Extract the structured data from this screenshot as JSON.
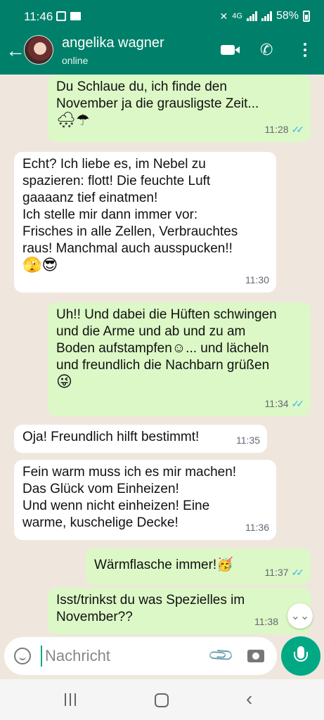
{
  "status_bar": {
    "time": "11:46",
    "network": "4G",
    "battery": "58%"
  },
  "header": {
    "contact_name": "angelika wagner",
    "contact_status": "online"
  },
  "messages": [
    {
      "dir": "out",
      "text": "Du Schlaue du, ich finde den\nNovember ja die grausligste Zeit...",
      "emoji": "🌨☂",
      "time": "11:28",
      "ticks": "✓✓"
    },
    {
      "dir": "in",
      "text": "Echt? Ich liebe es, im Nebel zu\nspazieren: flott! Die feuchte Luft\ngaaaanz tief einatmen!\nIch stelle mir dann immer vor:\nFrisches in alle Zellen, Verbrauchtes\nraus! Manchmal auch ausspucken!!",
      "emoji": "🫣😎",
      "time": "11:30"
    },
    {
      "dir": "out",
      "text": "Uh!! Und dabei die Hüften schwingen\nund die Arme und ab und zu am\nBoden aufstampfen☺... und lächeln\nund freundlich die Nachbarn grüßen",
      "emoji": "😜",
      "time": "11:34",
      "ticks": "✓✓"
    },
    {
      "dir": "in",
      "text": "Oja! Freundlich hilft bestimmt!",
      "time": "11:35"
    },
    {
      "dir": "in",
      "text": "Fein warm muss ich es mir machen!\nDas Glück vom Einheizen!\nUnd wenn nicht einheizen! Eine\nwarme, kuschelige Decke!",
      "time": "11:36"
    },
    {
      "dir": "out",
      "text": "Wärmflasche immer!🥳",
      "time": "11:37",
      "ticks": "✓✓"
    },
    {
      "dir": "out",
      "text": "Isst/trinkst du was Spezielles im\nNovember??",
      "time": "11:38"
    }
  ],
  "composer": {
    "placeholder": "Nachricht"
  },
  "colors": {
    "header": "#00806a",
    "outgoing": "#dcf8c6",
    "incoming": "#ffffff",
    "accent": "#00a884",
    "read_ticks": "#34b7f1",
    "background": "#efe7dd"
  },
  "icons": [
    "back-arrow-icon",
    "video-call-icon",
    "phone-icon",
    "more-vert-icon",
    "emoji-icon",
    "attach-icon",
    "camera-icon",
    "mic-icon",
    "scroll-down-icon"
  ]
}
